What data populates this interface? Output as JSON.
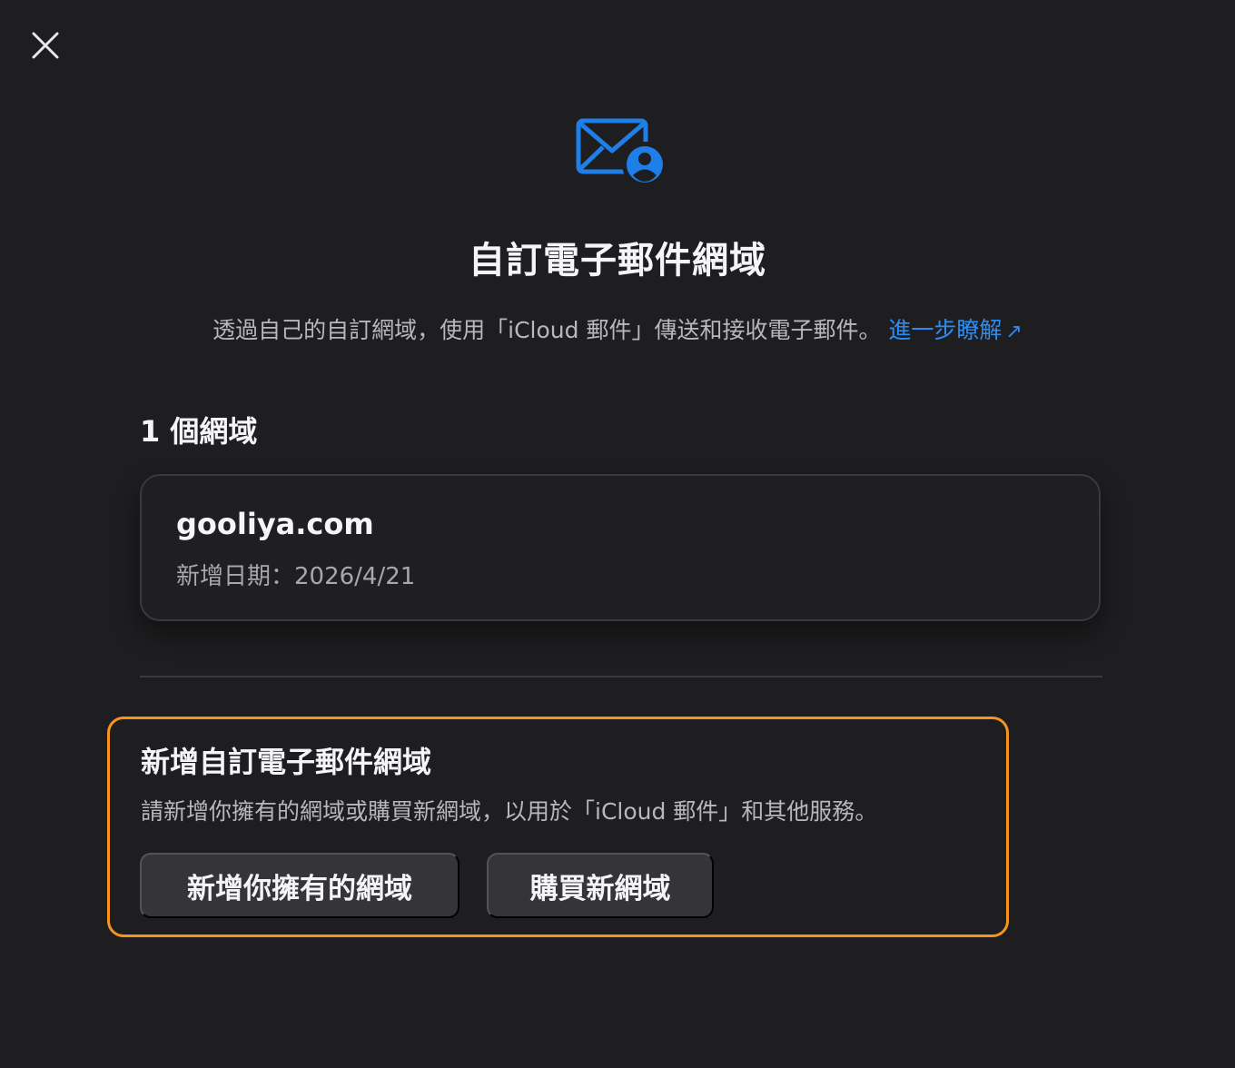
{
  "header": {
    "close_icon": "close-icon",
    "hero_icon": "mail-person-icon",
    "title": "自訂電子郵件網域",
    "subtitle": "透過自己的自訂網域，使用「iCloud 郵件」傳送和接收電子郵件。",
    "learn_more": "進一步瞭解",
    "learn_more_arrow": "↗"
  },
  "domains": {
    "count_label": "1 個網域",
    "items": [
      {
        "name": "gooliya.com",
        "added": "新增日期：2026/4/21"
      }
    ]
  },
  "add_section": {
    "title": "新增自訂電子郵件網域",
    "description": "請新增你擁有的網域或購買新網域，以用於「iCloud 郵件」和其他服務。",
    "add_own_button": "新增你擁有的網域",
    "buy_button": "購買新網域"
  },
  "colors": {
    "background": "#1e1e20",
    "accent": "#2d8cf0",
    "highlight_border": "#f7931e"
  }
}
